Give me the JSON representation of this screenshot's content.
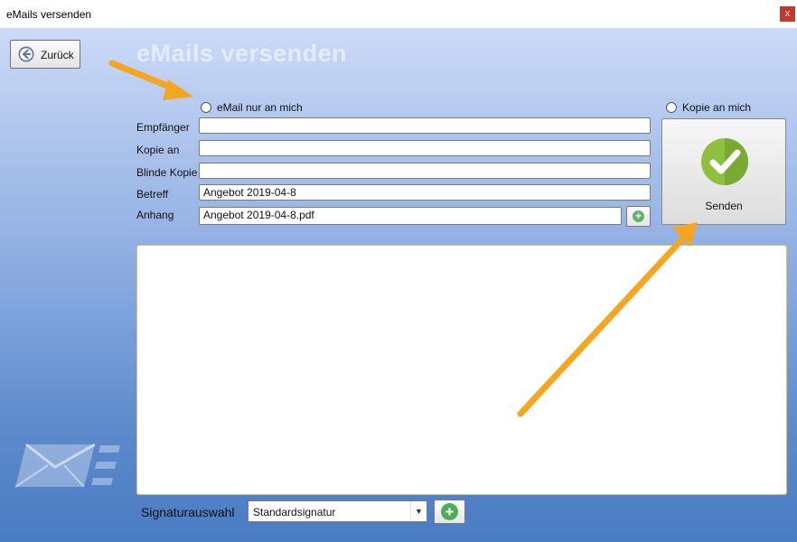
{
  "window": {
    "title": "eMails versenden",
    "close_glyph": "x"
  },
  "toolbar": {
    "back_label": "Zurück",
    "back_icon": "arrow-left-circle-icon"
  },
  "page_title": "eMails versenden",
  "options": {
    "only_me_label": "eMail nur an mich",
    "copy_to_me_label": "Kopie an mich"
  },
  "form": {
    "recipient_label": "Empfänger",
    "recipient_value": "",
    "cc_label": "Kopie an",
    "cc_value": "",
    "bcc_label": "Blinde Kopie",
    "bcc_value": "",
    "subject_label": "Betreff",
    "subject_value": "Angebot 2019-04-8",
    "attachment_label": "Anhang",
    "attachment_value": "Angebot 2019-04-8.pdf",
    "add_attachment_glyph": "+"
  },
  "send": {
    "label": "Senden",
    "icon": "checkmark-circle-icon",
    "icon_color": "#8fbf3f"
  },
  "signature": {
    "label": "Signaturauswahl",
    "selected": "Standardsignatur",
    "add_glyph": "+"
  },
  "colors": {
    "annotation_arrow": "#f4a620",
    "close_button": "#c8362c",
    "add_button": "#4cae5a",
    "body_border": "#e0c25a"
  }
}
